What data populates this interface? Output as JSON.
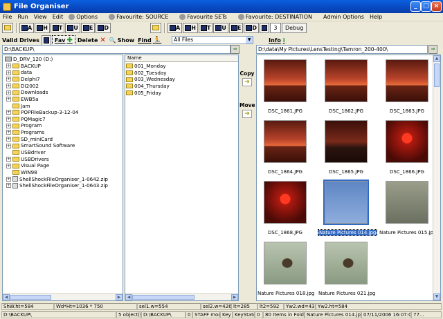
{
  "window": {
    "title": "File Organiser"
  },
  "menu": [
    "File",
    "Run",
    "View",
    "Edit",
    "Options",
    "Favourite: SOURCE",
    "Favourite SETs",
    "Favourite: DESTINATION",
    "Admin Options",
    "Help"
  ],
  "toolbar1": {
    "left_buttons": [
      "A",
      "H",
      "T",
      "U",
      "E",
      "D"
    ],
    "right_buttons": [
      "A",
      "H",
      "T",
      "U",
      "E",
      "D"
    ],
    "counter_value": "3",
    "debug_label": "Debug"
  },
  "toolbar2": {
    "valid_drives_label": "Valid Drives",
    "fav_label": "Fav",
    "delete_label": "Delete",
    "show_label": "Show",
    "find_label": "Find",
    "filter_value": "All Files",
    "info_label": "Info"
  },
  "left_path": "D:\\BACKUP\\",
  "right_path": "D:\\data\\My Pictures\\LensTesting\\Tamron_200-400\\",
  "tree": [
    {
      "label": "D_DRV_120 (D:)",
      "type": "drive",
      "expander": ""
    },
    {
      "label": "BACKUP",
      "type": "folder",
      "expander": "+"
    },
    {
      "label": "data",
      "type": "folder",
      "expander": "+"
    },
    {
      "label": "Delphi7",
      "type": "folder",
      "expander": "+"
    },
    {
      "label": "DI2002",
      "type": "folder",
      "expander": "+"
    },
    {
      "label": "Downloads",
      "type": "folder",
      "expander": "+"
    },
    {
      "label": "EWB5a",
      "type": "folder",
      "expander": "+"
    },
    {
      "label": "Jam",
      "type": "folder",
      "expander": ""
    },
    {
      "label": "POPFileBackup-3-12-04",
      "type": "folder",
      "expander": "+"
    },
    {
      "label": "PQMagic7",
      "type": "folder",
      "expander": "+"
    },
    {
      "label": "Program",
      "type": "folder",
      "expander": "+"
    },
    {
      "label": "Programs",
      "type": "folder",
      "expander": "+"
    },
    {
      "label": "SD_miniCard",
      "type": "folder",
      "expander": "+"
    },
    {
      "label": "SmartSound Software",
      "type": "folder",
      "expander": "+"
    },
    {
      "label": "USBdriver",
      "type": "folder",
      "expander": ""
    },
    {
      "label": "USBDrivers",
      "type": "folder",
      "expander": "+"
    },
    {
      "label": "Visual Page",
      "type": "folder",
      "expander": "+"
    },
    {
      "label": "WIN98",
      "type": "folder",
      "expander": ""
    },
    {
      "label": "ShellShockFileOrganiser_1-0642.zip",
      "type": "file",
      "expander": "+"
    },
    {
      "label": "ShellShockFileOrganiser_1-0643.zip",
      "type": "file",
      "expander": "+"
    }
  ],
  "list_header": "Name",
  "list_items": [
    "001_Monday",
    "002_Tuesday",
    "003_Wednesday",
    "004_Thursday",
    "005_Friday"
  ],
  "copy_label": "Copy",
  "move_label": "Move",
  "thumbnails": [
    {
      "caption": "DSC_1861.JPG",
      "selected": false,
      "kind": "tower"
    },
    {
      "caption": "DSC_1862.JPG",
      "selected": false,
      "kind": "tower"
    },
    {
      "caption": "DSC_1863.JPG",
      "selected": false,
      "kind": "tower"
    },
    {
      "caption": "DSC_1864.JPG",
      "selected": false,
      "kind": "tower"
    },
    {
      "caption": "DSC_1865.JPG",
      "selected": false,
      "kind": "tower-dark"
    },
    {
      "caption": "DSC_1866.JPG",
      "selected": false,
      "kind": "sunset"
    },
    {
      "caption": "DSC_1868.JPG",
      "selected": false,
      "kind": "sunset"
    },
    {
      "caption": "Nature Pictures 014.jpg",
      "selected": true,
      "kind": "sky-branches"
    },
    {
      "caption": "Nature Pictures 015.jpg",
      "selected": false,
      "kind": "grey-branches"
    },
    {
      "caption": "Nature Pictures 018.jpg",
      "selected": false,
      "kind": "bird"
    },
    {
      "caption": "Nature Pictures 021.jpg",
      "selected": false,
      "kind": "bird"
    }
  ],
  "status1": [
    "ShW.ht=584",
    "Wd*Ht=1036 * 750",
    "sel1.w=554",
    "sel2.w=426",
    "lt=285",
    "lt2=592",
    "Yw2.wd=437",
    "Yw2.ht=584"
  ],
  "status2": [
    "D:\\BACKUP\\",
    "5 object(s)",
    "D:\\BACKUP\\",
    "0",
    "STAFF mode",
    "Key",
    "KeyState",
    "0",
    "80 Items in Folder.",
    "Nature Pictures 014.jpg",
    "07/11/2006 16:07:04",
    "77..."
  ]
}
